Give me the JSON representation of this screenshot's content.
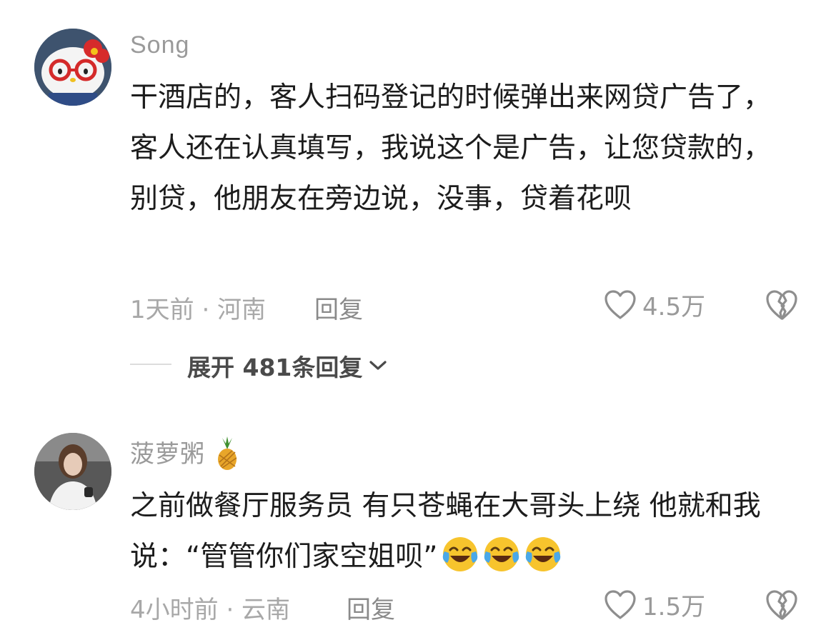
{
  "comments": [
    {
      "username": "Song",
      "text": "干酒店的，客人扫码登记的时候弹出来网贷广告了，客人还在认真填写，我说这个是广告，让您贷款的，别贷，他朋友在旁边说，没事，贷着花呗",
      "meta": "1天前 · 河南",
      "reply_label": "回复",
      "likes": "4.5万",
      "expand_label": "展开 481条回复",
      "avatar_icon": "hello-kitty-avatar"
    },
    {
      "username": "菠萝粥",
      "username_emoji": "pineapple-icon",
      "text": "之前做餐厅服务员 有只苍蝇在大哥头上绕 他就和我说：“管管你们家空姐呗”",
      "text_emojis": [
        "crying-laughing-emoji",
        "crying-laughing-emoji",
        "crying-laughing-emoji"
      ],
      "meta": "4小时前 · 云南",
      "reply_label": "回复",
      "likes": "1.5万",
      "avatar_icon": "person-photo-avatar"
    }
  ],
  "colors": {
    "text": "#1c1c1c",
    "muted": "#a8a8a8",
    "username": "#9a9a9a"
  }
}
